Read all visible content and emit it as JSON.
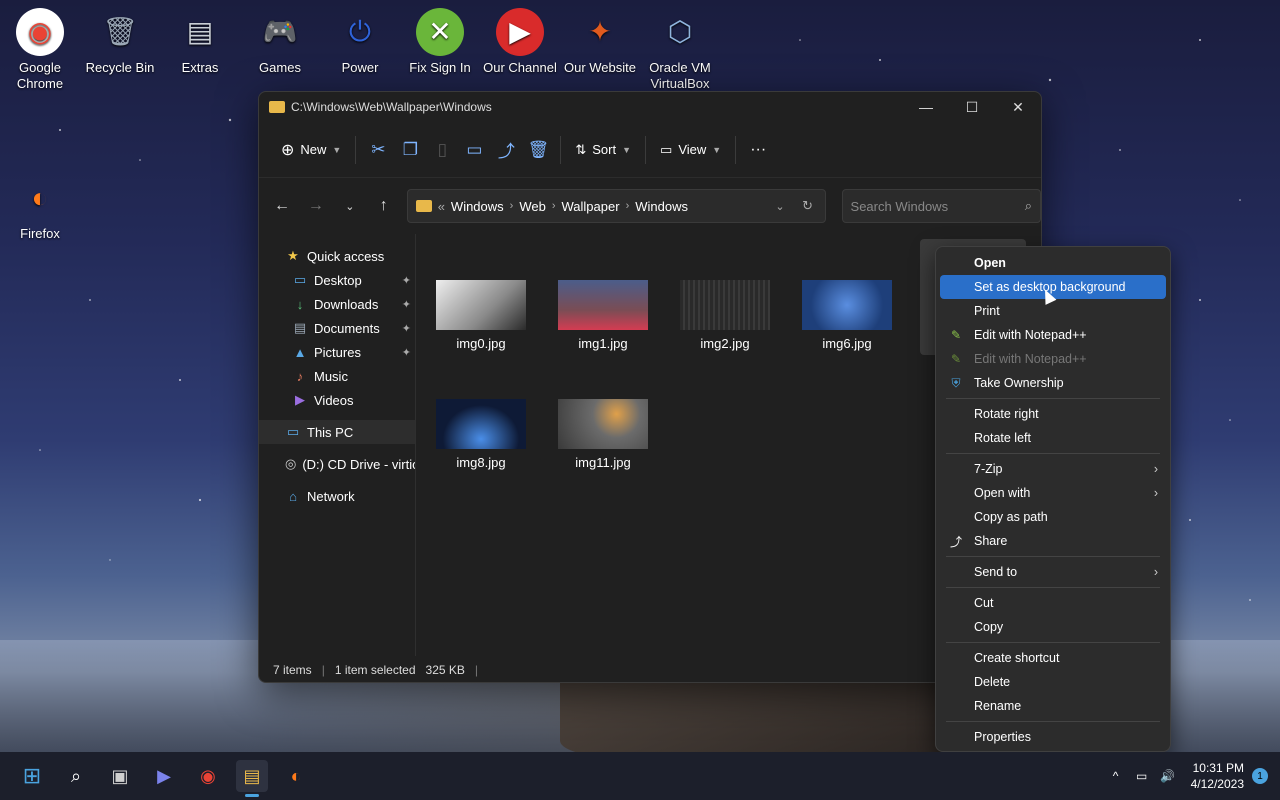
{
  "desktop": {
    "icons": [
      {
        "label": "Google Chrome",
        "glyph": "◉",
        "color": "#ea4335"
      },
      {
        "label": "Recycle Bin",
        "glyph": "🗑",
        "color": "#9aa7b5"
      },
      {
        "label": "Extras",
        "glyph": "▤",
        "color": "#c9cfd6"
      },
      {
        "label": "Games",
        "glyph": "🎮",
        "color": "#e8e8e8"
      },
      {
        "label": "Power",
        "glyph": "⏻",
        "color": "#2f63d9"
      },
      {
        "label": "Fix Sign In",
        "glyph": "✕",
        "color": "#6ab63a"
      },
      {
        "label": "Our Channel",
        "glyph": "▶",
        "color": "#d92b2b"
      },
      {
        "label": "Our Website",
        "glyph": "✦",
        "color": "#e05a1e"
      },
      {
        "label": "Oracle VM VirtualBox",
        "glyph": "⬡",
        "color": "#8fb4dd"
      },
      {
        "label": "Firefox",
        "glyph": "◐",
        "color": "#ff7a1a"
      }
    ]
  },
  "window": {
    "title": "C:\\Windows\\Web\\Wallpaper\\Windows",
    "controls": {
      "minimize": "—",
      "maximize": "☐",
      "close": "✕"
    },
    "toolbar": {
      "new_label": "New",
      "sort_label": "Sort",
      "view_label": "View",
      "more": "···"
    },
    "address": {
      "overflow": "«",
      "crumbs": [
        "Windows",
        "Web",
        "Wallpaper",
        "Windows"
      ]
    },
    "search_placeholder": "Search Windows",
    "sidebar": {
      "quick_access": "Quick access",
      "items": [
        {
          "label": "Desktop",
          "glyph": "▭",
          "color": "#5aa9e6",
          "pinned": true
        },
        {
          "label": "Downloads",
          "glyph": "↓",
          "color": "#5ac27a",
          "pinned": true
        },
        {
          "label": "Documents",
          "glyph": "▤",
          "color": "#9aa7b5",
          "pinned": true
        },
        {
          "label": "Pictures",
          "glyph": "▲",
          "color": "#5aa9e6",
          "pinned": true
        },
        {
          "label": "Music",
          "glyph": "♪",
          "color": "#e07a5f",
          "pinned": false
        },
        {
          "label": "Videos",
          "glyph": "▶",
          "color": "#9b6ee0",
          "pinned": false
        }
      ],
      "this_pc": "This PC",
      "cd_drive": "(D:) CD Drive - virtio",
      "network": "Network",
      "pin_glyph": "📌"
    },
    "files": [
      {
        "name": "img0.jpg",
        "color": "#c9c9c9"
      },
      {
        "name": "img1.jpg",
        "color": "#7a4d55"
      },
      {
        "name": "img2.jpg",
        "color": "#3a3a3a"
      },
      {
        "name": "img6.jpg",
        "color": "#2f5fa8"
      },
      {
        "name": "img8.jpg",
        "color": "#0e1a36"
      },
      {
        "name": "img11.jpg",
        "color": "#6b6b6b"
      }
    ],
    "status": {
      "items": "7 items",
      "selected": "1 item selected",
      "size": "325 KB"
    }
  },
  "context_menu": {
    "items": [
      {
        "label": "Open",
        "bold": true
      },
      {
        "label": "Set as desktop background",
        "highlighted": true
      },
      {
        "label": "Print"
      },
      {
        "label": "Edit with Notepad++",
        "glyph": "✎",
        "glyph_color": "#8bc34a"
      },
      {
        "label": "Edit with Notepad++",
        "glyph": "✎",
        "glyph_color": "#8bc34a",
        "disabled": true
      },
      {
        "label": "Take Ownership",
        "glyph": "⛨",
        "glyph_color": "#4aa3df"
      },
      {
        "separator": true
      },
      {
        "label": "Rotate right"
      },
      {
        "label": "Rotate left"
      },
      {
        "separator": true
      },
      {
        "label": "7-Zip",
        "submenu": true
      },
      {
        "label": "Open with",
        "submenu": true
      },
      {
        "label": "Copy as path"
      },
      {
        "label": "Share",
        "glyph": "⤴",
        "glyph_color": "#ffffff"
      },
      {
        "separator": true
      },
      {
        "label": "Send to",
        "submenu": true
      },
      {
        "separator": true
      },
      {
        "label": "Cut"
      },
      {
        "label": "Copy"
      },
      {
        "separator": true
      },
      {
        "label": "Create shortcut"
      },
      {
        "label": "Delete"
      },
      {
        "label": "Rename"
      },
      {
        "separator": true
      },
      {
        "label": "Properties"
      }
    ],
    "submenu_arrow": "›"
  },
  "taskbar": {
    "apps": [
      {
        "name": "start",
        "glyph": "⊞",
        "color": "#4aa3df"
      },
      {
        "name": "search",
        "glyph": "⌕",
        "color": "#ffffff"
      },
      {
        "name": "task-view",
        "glyph": "▣",
        "color": "#cfcfcf"
      },
      {
        "name": "teams-chat",
        "glyph": "▶",
        "color": "#7b83eb"
      },
      {
        "name": "chrome",
        "glyph": "◉",
        "color": "#ea4335"
      },
      {
        "name": "file-explorer",
        "glyph": "▤",
        "color": "#e8b84a"
      },
      {
        "name": "firefox",
        "glyph": "◐",
        "color": "#ff7a1a"
      }
    ],
    "tray": {
      "chevron": "^",
      "network": "▭",
      "volume": "🔊"
    },
    "time": "10:31 PM",
    "date": "4/12/2023",
    "notifications": "1"
  }
}
